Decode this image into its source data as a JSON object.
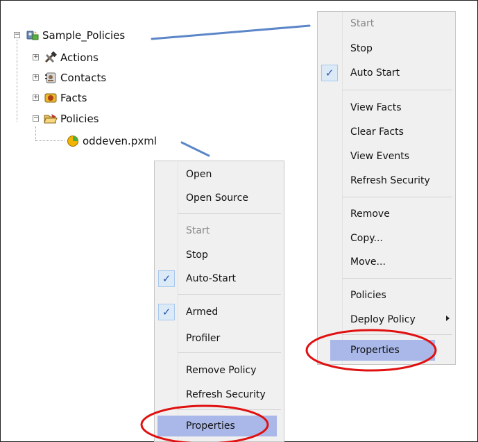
{
  "tree": {
    "root": {
      "label": "Sample_Policies",
      "icon": "policy-server-icon"
    },
    "children": [
      {
        "label": "Actions",
        "icon": "tools-icon",
        "expander": "+"
      },
      {
        "label": "Contacts",
        "icon": "contacts-icon",
        "expander": "+"
      },
      {
        "label": "Facts",
        "icon": "facts-icon",
        "expander": "+"
      },
      {
        "label": "Policies",
        "icon": "folder-open-icon",
        "expander": "-"
      }
    ],
    "policy_file": {
      "label": "oddeven.pxml",
      "icon": "policy-file-icon"
    }
  },
  "server_menu": {
    "items": [
      {
        "label": "Start",
        "disabled": true
      },
      {
        "label": "Stop"
      },
      {
        "label": "Auto Start",
        "checked": true
      },
      {
        "label": "View Facts"
      },
      {
        "label": "Clear Facts"
      },
      {
        "label": "View Events"
      },
      {
        "label": "Refresh Security"
      },
      {
        "label": "Remove"
      },
      {
        "label": "Copy..."
      },
      {
        "label": "Move..."
      },
      {
        "label": "Policies"
      },
      {
        "label": "Deploy Policy",
        "submenu": true
      },
      {
        "label": "Properties",
        "highlighted": true
      }
    ]
  },
  "policy_menu": {
    "items": [
      {
        "label": "Open"
      },
      {
        "label": "Open Source"
      },
      {
        "label": "Start",
        "disabled": true
      },
      {
        "label": "Stop"
      },
      {
        "label": "Auto-Start",
        "checked": true
      },
      {
        "label": "Armed",
        "checked": true
      },
      {
        "label": "Profiler"
      },
      {
        "label": "Remove Policy"
      },
      {
        "label": "Refresh Security"
      },
      {
        "label": "Properties",
        "highlighted": true
      }
    ]
  },
  "colors": {
    "connector": "#5b86c8",
    "highlight_ring": "#e01010",
    "menu_highlight": "#a9b8e8",
    "check": "#2454a8"
  },
  "check_glyph": "✓"
}
